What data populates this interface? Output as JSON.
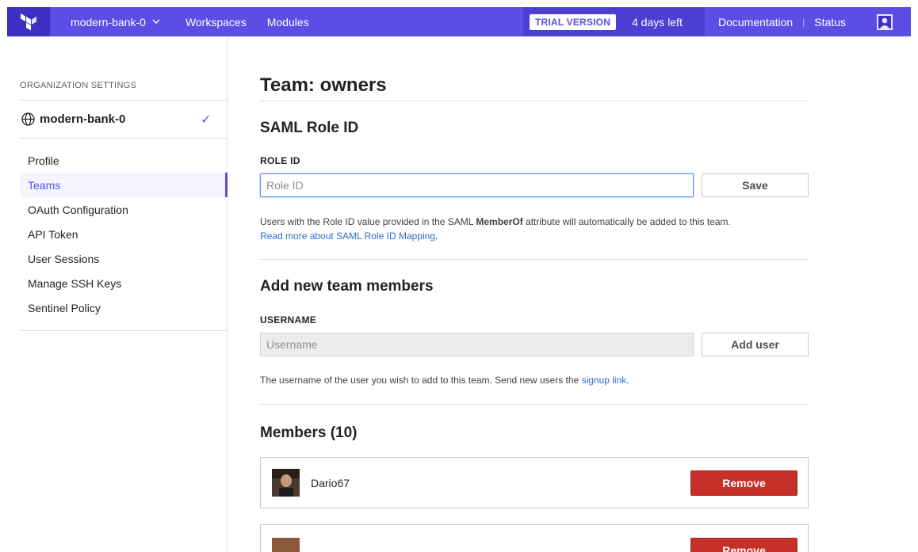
{
  "topnav": {
    "org_name": "modern-bank-0",
    "links": [
      "Workspaces",
      "Modules"
    ],
    "trial_badge": "TRIAL VERSION",
    "days_left": "4 days left",
    "documentation": "Documentation",
    "separator": "|",
    "status": "Status",
    "brand_color": "#5c4ee5"
  },
  "sidebar": {
    "section_label": "ORGANIZATION SETTINGS",
    "org_name": "modern-bank-0",
    "items": [
      {
        "label": "Profile",
        "active": false
      },
      {
        "label": "Teams",
        "active": true
      },
      {
        "label": "OAuth Configuration",
        "active": false
      },
      {
        "label": "API Token",
        "active": false
      },
      {
        "label": "User Sessions",
        "active": false
      },
      {
        "label": "Manage SSH Keys",
        "active": false
      },
      {
        "label": "Sentinel Policy",
        "active": false
      }
    ]
  },
  "main": {
    "title": "Team: owners",
    "saml": {
      "heading": "SAML Role ID",
      "field_label": "ROLE ID",
      "placeholder": "Role ID",
      "value": "",
      "save_label": "Save",
      "help_pre": "Users with the Role ID value provided in the SAML ",
      "help_bold": "MemberOf",
      "help_post": " attribute will automatically be added to this team.",
      "help_link": "Read more about SAML Role ID Mapping",
      "help_link_end": "."
    },
    "add_members": {
      "heading": "Add new team members",
      "field_label": "USERNAME",
      "placeholder": "Username",
      "add_label": "Add user",
      "help_pre": "The username of the user you wish to add to this team. Send new users the ",
      "help_link": "signup link",
      "help_end": "."
    },
    "members": {
      "heading": "Members (10)",
      "remove_label": "Remove",
      "list": [
        {
          "username": "Dario67"
        },
        {
          "username": ""
        }
      ]
    }
  },
  "colors": {
    "accent": "#5c4ee5",
    "danger": "#c73029",
    "link": "#2f6dd4"
  }
}
